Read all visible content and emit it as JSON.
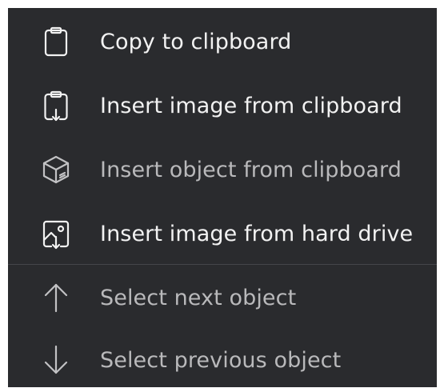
{
  "menu": {
    "items": [
      {
        "label": "Copy to clipboard",
        "icon": "clipboard-icon",
        "state": "enabled"
      },
      {
        "label": "Insert image from clipboard",
        "icon": "clipboard-download-icon",
        "state": "enabled"
      },
      {
        "label": "Insert object from clipboard",
        "icon": "cube-icon",
        "state": "disabled"
      },
      {
        "label": "Insert image from hard drive",
        "icon": "image-download-icon",
        "state": "enabled"
      },
      {
        "label": "Select next object",
        "icon": "arrow-up-icon",
        "state": "disabled"
      },
      {
        "label": "Select previous object",
        "icon": "arrow-down-icon",
        "state": "disabled"
      }
    ]
  },
  "colors": {
    "menu_background": "#2a2b2e",
    "enabled_text": "#f2f2f2",
    "disabled_text": "#b9b9bb",
    "divider": "#45464a"
  }
}
